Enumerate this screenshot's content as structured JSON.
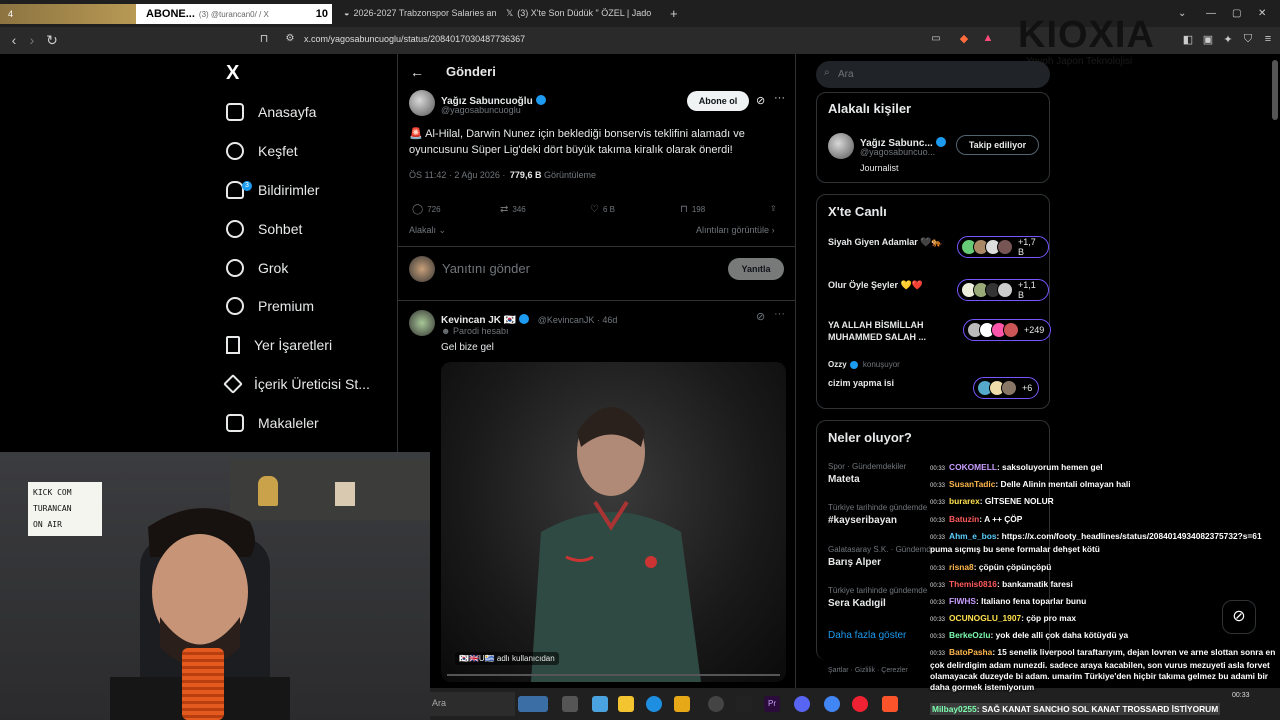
{
  "browser": {
    "tabs": [
      {
        "stripe_label": "4",
        "label": "ABONE...",
        "sub": "(3) @turancan0/ / X",
        "count": "10"
      },
      {
        "label": "2026-2027 Trabzonspor Salaries and"
      },
      {
        "label": "(3) X'te Son Düdük \" ÖZEL | Jado"
      }
    ],
    "url": "x.com/yagosabuncuoglu/status/2084017030487736367"
  },
  "sponsor": {
    "brand": "KIOXIA",
    "tagline": "Yoyoh Japon Teknolojisi"
  },
  "sidebar": {
    "logo": "X",
    "items": [
      {
        "label": "Anasayfa"
      },
      {
        "label": "Keşfet"
      },
      {
        "label": "Bildirimler",
        "badge": "3"
      },
      {
        "label": "Sohbet"
      },
      {
        "label": "Grok"
      },
      {
        "label": "Premium"
      },
      {
        "label": "Yer İşaretleri"
      },
      {
        "label": "İçerik Üreticisi St..."
      },
      {
        "label": "Makaleler"
      }
    ]
  },
  "post": {
    "header": "Gönderi",
    "author_name": "Yağız Sabuncuoğlu",
    "author_handle": "@yagosabuncuoglu",
    "subscribe_label": "Abone ol",
    "text": "🚨 Al-Hilal, Darwin Nunez için beklediği bonservis teklifini alamadı ve oyuncusunu Süper Lig'deki dört büyük takıma kiralık olarak önerdi!",
    "time": "ÖS 11:42 · 2 Ağu 2026 ·",
    "views": "779,6 B",
    "views_label": "Görüntüleme",
    "stats": {
      "replies": "726",
      "reposts": "346",
      "likes": "6 B",
      "bookmarks": "198"
    },
    "relevance": "Alakalı",
    "quotes_label": "Alıntıları görüntüle",
    "reply_placeholder": "Yanıtını gönder",
    "reply_button": "Yanıtla"
  },
  "reply": {
    "author_name": "Kevincan JK 🇰🇷",
    "author_handle": "@KevincanJK · 46d",
    "parody": "Parodi hesabı",
    "text": "Gel bize gel",
    "video_caption": "🇰🇷🇬🇧U🇺🇾 adlı kullanıcıdan"
  },
  "right": {
    "search_placeholder": "Ara",
    "related_title": "Alakalı kişiler",
    "related_person": {
      "name": "Yağız Sabunc...",
      "handle": "@yagosabuncuo...",
      "bio": "Journalist",
      "button": "Takip ediliyor"
    },
    "live_title": "X'te Canlı",
    "live": [
      {
        "title": "Siyah Giyen Adamlar 🖤🐅",
        "count": "+1,7 B"
      },
      {
        "title": "Olur Öyle Şeyler 💛❤️",
        "count": "+1,1 B"
      },
      {
        "title": "YA ALLAH BİSMİLLAH MUHAMMED SALAH ...",
        "count": "+249"
      },
      {
        "host": "Ozzy",
        "host_status": "konuşuyor",
        "title": "cizim yapma isi",
        "count": "+6"
      }
    ],
    "trends_title": "Neler oluyor?",
    "trends": [
      {
        "cat": "Spor · Gündemdekiler",
        "name": "Mateta"
      },
      {
        "cat": "Türkiye tarihinde gündemde",
        "name": "#kayseribayan"
      },
      {
        "cat": "Galatasaray S.K. · Gündemde",
        "name": "Barış Alper"
      },
      {
        "cat": "Türkiye tarihinde gündemde",
        "name": "Sera Kadıgil"
      }
    ],
    "more": "Daha fazla göster",
    "footer": "Şartlar · Gizlilik · Çerezler"
  },
  "webcam_sign": [
    "KICK COM",
    "TURANCAN",
    "ON AIR"
  ],
  "taskbar": {
    "search": "Ara",
    "clock": "00:33"
  },
  "chat": [
    {
      "time": "00:33",
      "user": "COKOMELL",
      "color": "#c99dff",
      "msg": ": saksoluyorum hemen gel"
    },
    {
      "time": "00:33",
      "user": "SusanTadic",
      "color": "#ffb84d",
      "msg": ": Delle Alinin mentali olmayan hali"
    },
    {
      "time": "00:33",
      "user": "burarex",
      "color": "#ffe14d",
      "msg": ": GİTSENE NOLUR"
    },
    {
      "time": "00:33",
      "user": "Batuzin",
      "color": "#ff5a5a",
      "msg": ": A ++ ÇÖP"
    },
    {
      "time": "00:33",
      "user": "Ahm_e_bos",
      "color": "#5ad1ff",
      "msg": ": https://x.com/footy_headlines/status/2084014934082375732?s=61 puma sıçmış bu sene formalar dehşet kötü"
    },
    {
      "time": "00:33",
      "user": "risna8",
      "color": "#ffb84d",
      "msg": ": çöpün çöpünçöpü"
    },
    {
      "time": "00:33",
      "user": "Themis0816",
      "color": "#ff5a5a",
      "msg": ": bankamatik faresi"
    },
    {
      "time": "00:33",
      "user": "FIWHS",
      "color": "#c99dff",
      "msg": ": Italiano fena toparlar bunu"
    },
    {
      "time": "00:33",
      "user": "OCUNOGLU_1907",
      "color": "#ffe14d",
      "msg": ": çöp pro max"
    },
    {
      "time": "00:33",
      "user": "BerkeOzlu",
      "color": "#7dffb0",
      "msg": ": yok dele alli çok daha kötüydü ya"
    },
    {
      "time": "00:33",
      "user": "BatoPasha",
      "color": "#ffb84d",
      "msg": ": 15 senelik liverpool taraftarıyım, dejan lovren ve arne slottan sonra en çok delirdigim adam nunezdi. sadece araya kacabilen, son vurus mezuyeti asla forvet olamayacak duzeyde bi adam. umarim Türkiye'den hiçbir takıma gelmez bu adami bir daha gormek istemiyorum"
    }
  ],
  "chat_last": {
    "user": "Milbay0255",
    "color": "#7dffb0",
    "msg": ": SAĞ KANAT SANCHO SOL KANAT TROSSARD İSTİYORUM"
  }
}
